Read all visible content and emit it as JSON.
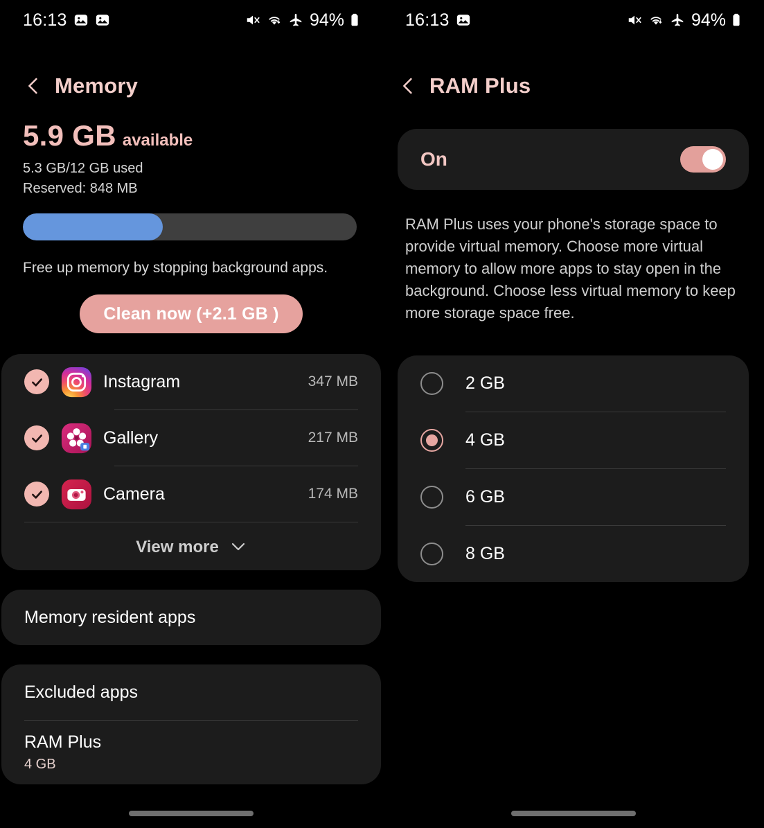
{
  "status_bar": {
    "time": "16:13",
    "battery_percent": "94%",
    "left_icons": [
      "image-icon",
      "image-icon"
    ],
    "left_icons_right_panel": [
      "image-icon"
    ],
    "right_icons": [
      "mute-icon",
      "wifi-icon",
      "airplane-mode-icon",
      "battery-icon"
    ]
  },
  "memory_screen": {
    "title": "Memory",
    "back_icon": "back-chevron-icon",
    "available_value": "5.9 GB",
    "available_label": "available",
    "used_line": "5.3 GB/12 GB used",
    "reserved_line": "Reserved: 848 MB",
    "usage_percent": 42,
    "bar_fill_color": "#6596dd",
    "bar_track_color": "#3f3f3f",
    "hint": "Free up memory by stopping background apps.",
    "clean_button": "Clean now (+2.1 GB )",
    "clean_button_color": "#e6a29e",
    "apps": [
      {
        "name": "Instagram",
        "size": "347 MB",
        "icon": "instagram-icon",
        "checked": true
      },
      {
        "name": "Gallery",
        "size": "217 MB",
        "icon": "gallery-icon",
        "checked": true
      },
      {
        "name": "Camera",
        "size": "174 MB",
        "icon": "camera-icon",
        "checked": true
      }
    ],
    "view_more": "View more",
    "view_more_icon": "chevron-down-icon",
    "memory_resident_apps": "Memory resident apps",
    "excluded_apps": "Excluded apps",
    "ram_plus_label": "RAM Plus",
    "ram_plus_value": "4 GB"
  },
  "ram_plus_screen": {
    "title": "RAM Plus",
    "back_icon": "back-chevron-icon",
    "toggle_label": "On",
    "toggle_on": true,
    "toggle_color": "#e3a09b",
    "description": "RAM Plus uses your phone's storage space to provide virtual memory. Choose more virtual memory to allow more apps to stay open in the background. Choose less virtual memory to keep more storage space free.",
    "options": [
      {
        "label": "2 GB",
        "selected": false
      },
      {
        "label": "4 GB",
        "selected": true
      },
      {
        "label": "6 GB",
        "selected": false
      },
      {
        "label": "8 GB",
        "selected": false
      }
    ],
    "accent_color": "#e6a6a1"
  }
}
